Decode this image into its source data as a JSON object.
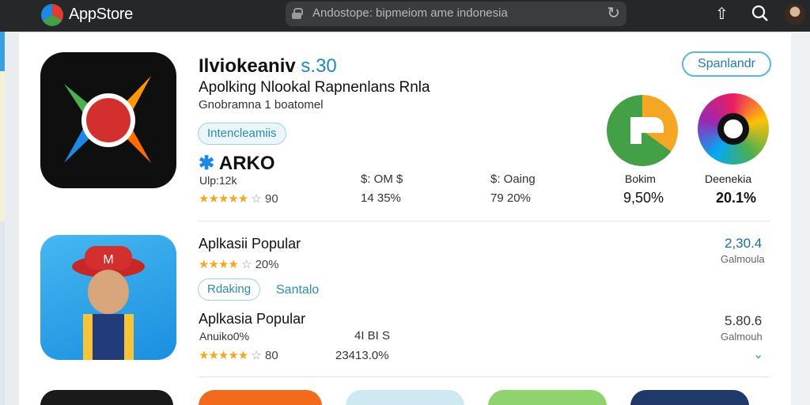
{
  "topbar": {
    "logo": "AppStore",
    "url": "Andostope: bipmeiom ame indonesia"
  },
  "featured": {
    "title": "Ilviokeaniv",
    "version": "s.30",
    "subtitle": "Apolking Nlookal Rapnenlans Rnla",
    "developer": "Gnobramna 1 boatomel",
    "tag": "Intencleamiis",
    "brand": "ARKO",
    "install_button": "Spanlandr",
    "stats": [
      {
        "label": "Ulp:12k",
        "value": "90",
        "stars": 4.5
      },
      {
        "label": "$: OM $",
        "value": "14 35%"
      },
      {
        "label": "$: Oaing",
        "value": "79 20%"
      }
    ],
    "mini_apps": [
      {
        "name": "Bokim",
        "value": "9,50%"
      },
      {
        "name": "Deenekia",
        "value": "20.1%"
      }
    ]
  },
  "second": {
    "title": "Aplkasii Popular",
    "rating_pct": "20%",
    "price": "2,30.4",
    "price_sub": "Galmoula",
    "links": [
      "Rdaking",
      "Santalo"
    ],
    "title2": "Aplkasia Popular",
    "sub2": "Anuiko0%",
    "mid": "4I BI S",
    "mid_value": "23413.0%",
    "rating_value": "80",
    "price2": "5.80.6",
    "price2_sub": "Galmouh",
    "stars": 4.5
  },
  "colors": {
    "accent": "#1e88c5",
    "star": "#f5a623",
    "topbar": "#262728"
  },
  "icons": [
    "app-logo",
    "lock-icon",
    "reload-icon",
    "share-icon",
    "search-icon",
    "avatar",
    "star-icon",
    "chevron-down-icon"
  ]
}
